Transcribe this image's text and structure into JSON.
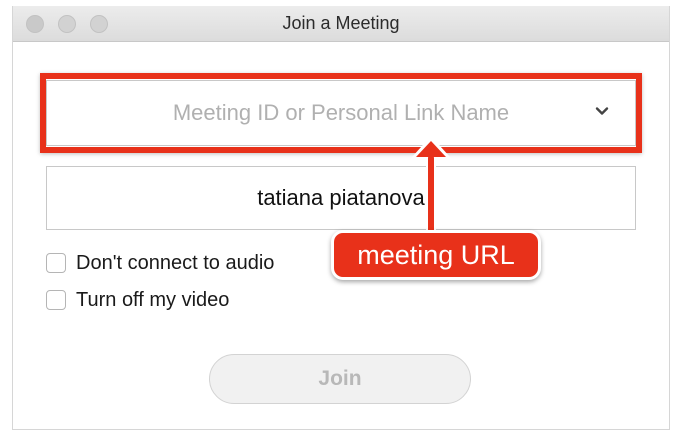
{
  "window": {
    "title": "Join a Meeting"
  },
  "meeting_id": {
    "placeholder": "Meeting ID or Personal Link Name",
    "value": "",
    "dropdown_icon": "chevron-down-icon"
  },
  "name": {
    "value": "tatiana piatanova"
  },
  "options": {
    "audio_label": "Don't connect to audio",
    "audio_checked": false,
    "video_label": "Turn off my video",
    "video_checked": false
  },
  "join_button": {
    "label": "Join",
    "enabled": false
  },
  "annotation": {
    "callout_text": "meeting URL",
    "color": "#e8311a"
  }
}
